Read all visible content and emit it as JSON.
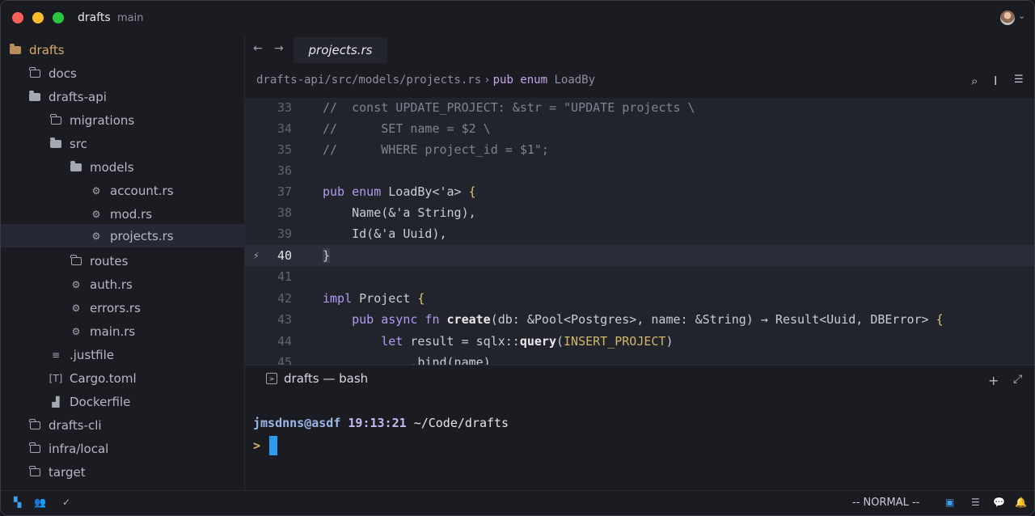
{
  "window": {
    "project": "drafts",
    "branch": "main"
  },
  "sidebar": {
    "items": [
      {
        "label": "drafts",
        "icon": "folder-open-icon"
      },
      {
        "label": "docs",
        "icon": "folder-icon"
      },
      {
        "label": "drafts-api",
        "icon": "folder-open-icon"
      },
      {
        "label": "migrations",
        "icon": "folder-icon"
      },
      {
        "label": "src",
        "icon": "folder-open-icon"
      },
      {
        "label": "models",
        "icon": "folder-open-icon"
      },
      {
        "label": "account.rs",
        "icon": "rust-file-icon"
      },
      {
        "label": "mod.rs",
        "icon": "rust-file-icon"
      },
      {
        "label": "projects.rs",
        "icon": "rust-file-icon",
        "selected": true
      },
      {
        "label": "routes",
        "icon": "folder-icon"
      },
      {
        "label": "auth.rs",
        "icon": "rust-file-icon"
      },
      {
        "label": "errors.rs",
        "icon": "rust-file-icon"
      },
      {
        "label": "main.rs",
        "icon": "rust-file-icon"
      },
      {
        "label": ".justfile",
        "icon": "text-file-icon"
      },
      {
        "label": "Cargo.toml",
        "icon": "toml-file-icon"
      },
      {
        "label": "Dockerfile",
        "icon": "docker-icon"
      },
      {
        "label": "drafts-cli",
        "icon": "folder-icon"
      },
      {
        "label": "infra/local",
        "icon": "folder-icon"
      },
      {
        "label": "target",
        "icon": "folder-icon"
      }
    ]
  },
  "editor": {
    "tab": "projects.rs",
    "breadcrumb": {
      "path": "drafts-api/src/models/projects.rs",
      "separator": "›",
      "keywords": "pub enum",
      "symbol": "LoadBy"
    },
    "active_line": "40",
    "line_numbers": [
      "33",
      "34",
      "35",
      "36",
      "37",
      "38",
      "39",
      "40",
      "41",
      "42",
      "43",
      "44",
      "45"
    ],
    "lines": {
      "l33": "//  const UPDATE_PROJECT: &str = \"UPDATE projects \\",
      "l34": "//      SET name = $2 \\",
      "l35": "//      WHERE project_id = $1\";",
      "l37a": "pub enum",
      "l37b": " LoadBy<'a> ",
      "l37c": "{",
      "l38": "    Name(&'a String),",
      "l39": "    Id(&'a Uuid),",
      "l40": "}",
      "l42a": "impl",
      "l42b": " Project ",
      "l42c": "{",
      "l43a": "    pub async fn",
      "l43b": " create",
      "l43c": "(db: &Pool<Postgres>, name: &String) → Result<Uuid, DBError> ",
      "l43d": "{",
      "l44a": "        let",
      "l44b": " result = sqlx::",
      "l44c": "query",
      "l44d": "(",
      "l44e": "INSERT_PROJECT",
      "l44f": ")",
      "l45": "            .bind(name)"
    }
  },
  "terminal": {
    "tab": "drafts — bash",
    "user": "jmsdnns@asdf",
    "time": "19:13:21",
    "path": "~/Code/drafts",
    "prompt": ">"
  },
  "status": {
    "mode": "-- NORMAL --"
  }
}
